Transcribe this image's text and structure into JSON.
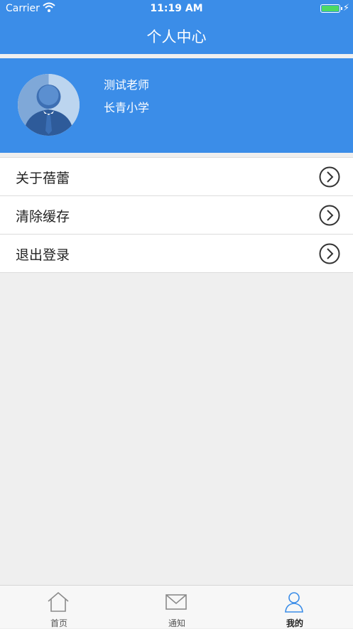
{
  "status_bar": {
    "carrier": "Carrier",
    "time": "11:19 AM"
  },
  "nav": {
    "title": "个人中心"
  },
  "profile": {
    "name": "测试老师",
    "school": "长青小学"
  },
  "menu": {
    "items": [
      {
        "label": "关于蓓蕾"
      },
      {
        "label": "清除缓存"
      },
      {
        "label": "退出登录"
      }
    ]
  },
  "tabbar": {
    "tabs": [
      {
        "label": "首页",
        "icon": "home-icon"
      },
      {
        "label": "通知",
        "icon": "mail-icon"
      },
      {
        "label": "我的",
        "icon": "user-icon"
      }
    ],
    "active_index": 2
  },
  "colors": {
    "primary": "#3b8de8",
    "background": "#efefef",
    "active_tab": "#3b8de8"
  }
}
